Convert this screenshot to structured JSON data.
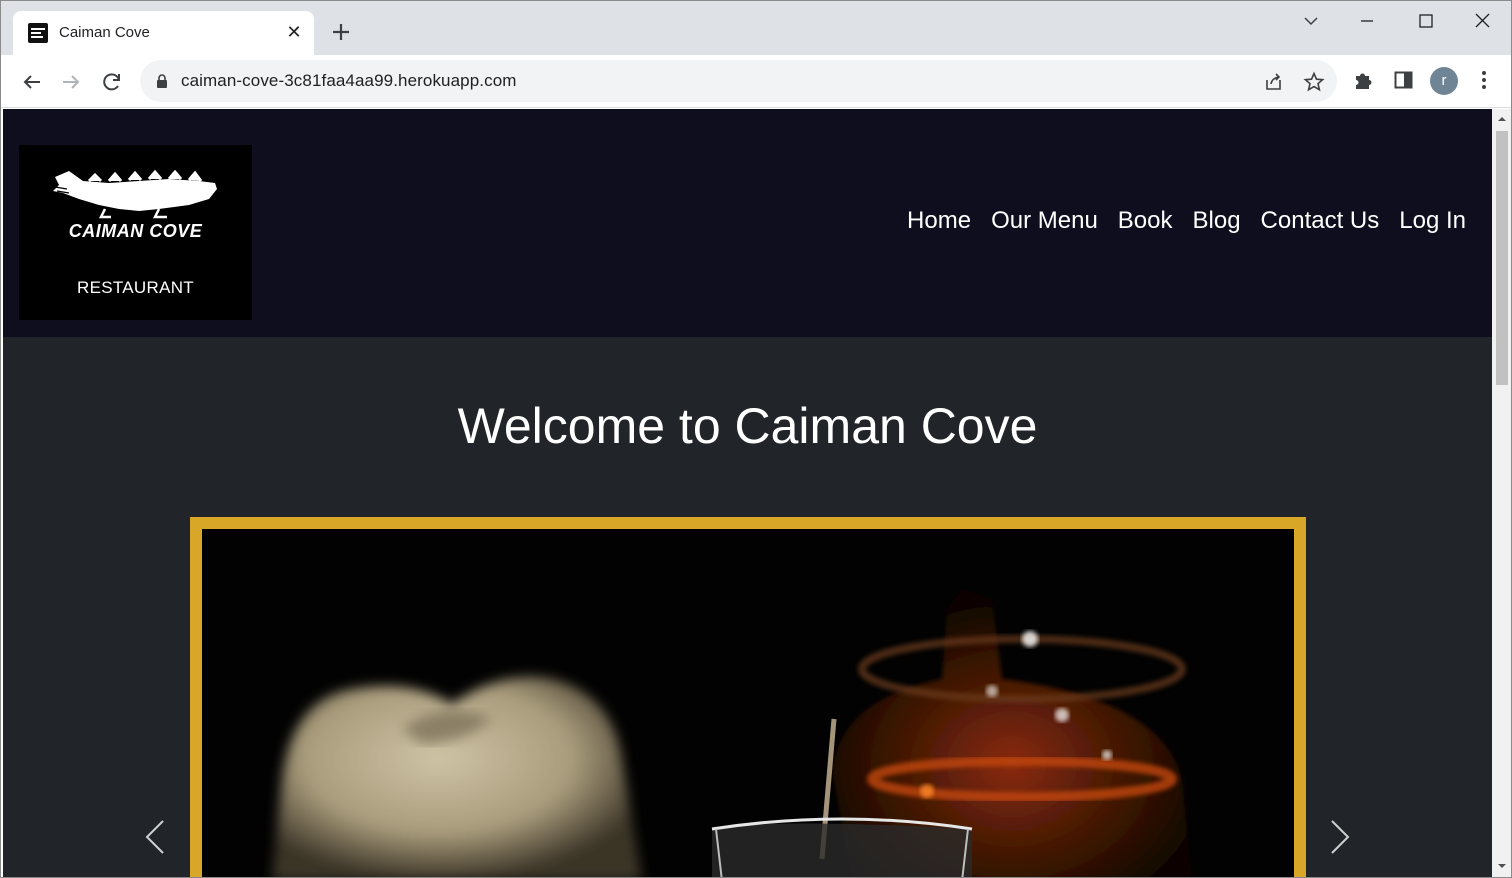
{
  "browser": {
    "tab_title": "Caiman Cove",
    "tab_close": "✕",
    "url": "caiman-cove-3c81faa4aa99.herokuapp.com",
    "profile_initial": "r",
    "icons": [
      "back-icon",
      "forward-icon",
      "reload-icon",
      "lock-icon",
      "share-icon",
      "bookmark-star-icon",
      "extensions-icon",
      "side-panel-icon",
      "kebab-menu-icon",
      "tab-search-icon",
      "minimize-icon",
      "maximize-icon",
      "close-icon"
    ]
  },
  "site": {
    "logo": {
      "brand": "CAIMAN COVE",
      "subtitle": "RESTAURANT"
    },
    "nav": [
      {
        "label": "Home"
      },
      {
        "label": "Our Menu"
      },
      {
        "label": "Book"
      },
      {
        "label": "Blog"
      },
      {
        "label": "Contact Us"
      },
      {
        "label": "Log In"
      }
    ],
    "heading": "Welcome to Caiman Cove",
    "carousel": {
      "frame_color": "#d9a727",
      "prev_icon": "chevron-left-icon",
      "next_icon": "chevron-right-icon"
    },
    "colors": {
      "header_bg": "#0f0e1f",
      "page_bg": "#212529"
    }
  }
}
